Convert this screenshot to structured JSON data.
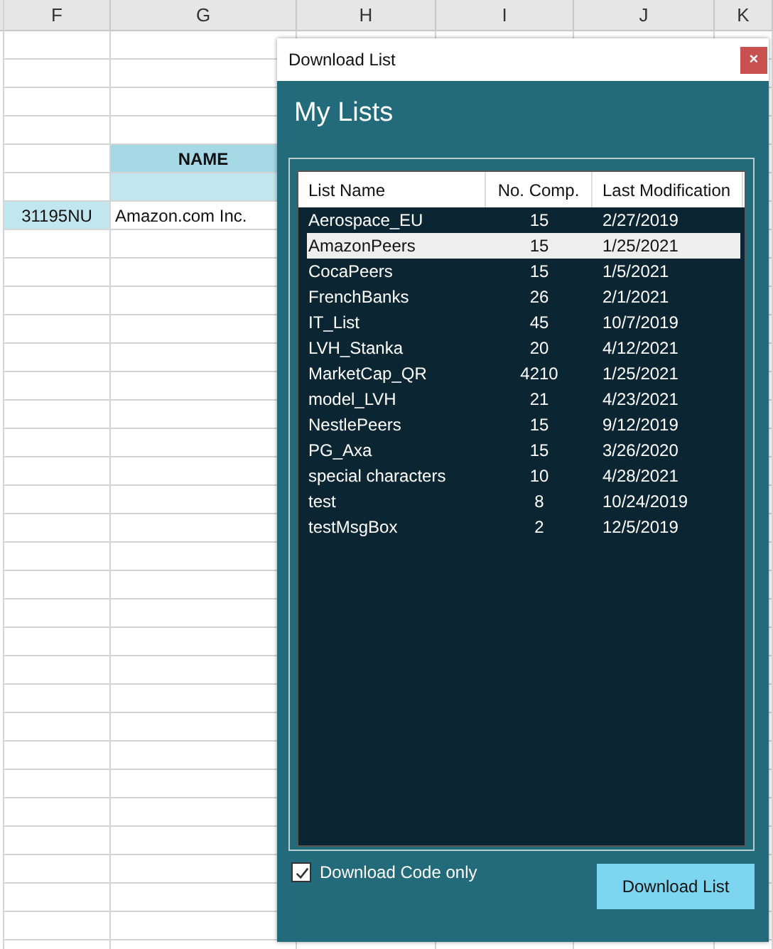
{
  "sheet": {
    "columns": [
      "F",
      "G",
      "H",
      "I",
      "J",
      "K"
    ],
    "rows": [
      {
        "kind": "blank"
      },
      {
        "kind": "blank"
      },
      {
        "kind": "blank"
      },
      {
        "kind": "blank"
      },
      {
        "kind": "header",
        "G": "NAME"
      },
      {
        "kind": "band"
      },
      {
        "kind": "record",
        "F": "31195NU",
        "G": "Amazon.com Inc."
      }
    ]
  },
  "dialog": {
    "title": "Download List",
    "close": "×",
    "heading": "My Lists",
    "list": {
      "columns": [
        "List Name",
        "No. Comp.",
        "Last Modification"
      ],
      "rows": [
        {
          "name": "Aerospace_EU",
          "count": "15",
          "modified": "2/27/2019",
          "selected": false
        },
        {
          "name": "AmazonPeers",
          "count": "15",
          "modified": "1/25/2021",
          "selected": true
        },
        {
          "name": "CocaPeers",
          "count": "15",
          "modified": "1/5/2021",
          "selected": false
        },
        {
          "name": "FrenchBanks",
          "count": "26",
          "modified": "2/1/2021",
          "selected": false
        },
        {
          "name": "IT_List",
          "count": "45",
          "modified": "10/7/2019",
          "selected": false
        },
        {
          "name": "LVH_Stanka",
          "count": "20",
          "modified": "4/12/2021",
          "selected": false
        },
        {
          "name": "MarketCap_QR",
          "count": "4210",
          "modified": "1/25/2021",
          "selected": false
        },
        {
          "name": "model_LVH",
          "count": "21",
          "modified": "4/23/2021",
          "selected": false
        },
        {
          "name": "NestlePeers",
          "count": "15",
          "modified": "9/12/2019",
          "selected": false
        },
        {
          "name": "PG_Axa",
          "count": "15",
          "modified": "3/26/2020",
          "selected": false
        },
        {
          "name": "special characters",
          "count": "10",
          "modified": "4/28/2021",
          "selected": false
        },
        {
          "name": "test",
          "count": "8",
          "modified": "10/24/2019",
          "selected": false
        },
        {
          "name": "testMsgBox",
          "count": "2",
          "modified": "12/5/2019",
          "selected": false
        }
      ]
    },
    "checkbox": {
      "label": "Download Code only",
      "checked": true
    },
    "button": "Download List"
  }
}
